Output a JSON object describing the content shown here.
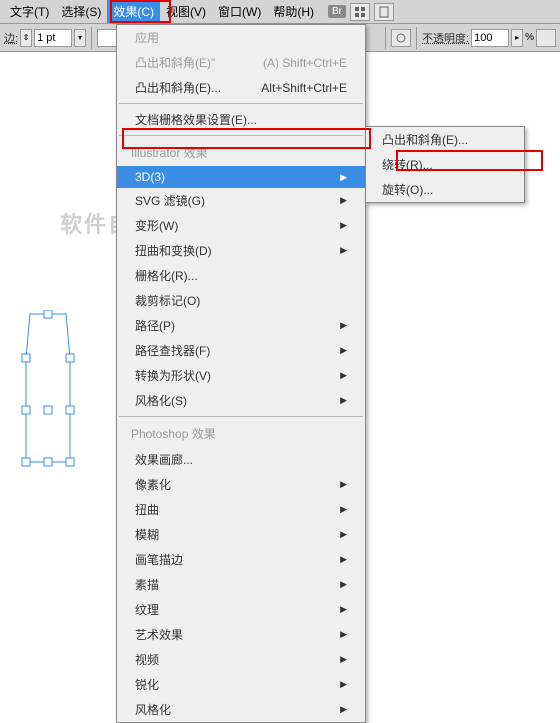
{
  "menubar": {
    "items": [
      "文字(T)",
      "选择(S)",
      "效果(C)",
      "视图(V)",
      "窗口(W)",
      "帮助(H)"
    ],
    "br": "Br"
  },
  "toolbar": {
    "stroke_label": "边:",
    "stroke_value": "1 pt",
    "opacity_label": "不透明度:",
    "opacity_value": "100",
    "percent": "%"
  },
  "dropdown": {
    "row0": {
      "label": "应用",
      "shortcut": ""
    },
    "row1": {
      "label": "凸出和斜角(E)\"",
      "shortcut": "(A)   Shift+Ctrl+E"
    },
    "row2": {
      "label": "凸出和斜角(E)...",
      "shortcut": "Alt+Shift+Ctrl+E"
    },
    "row3": {
      "label": "文档栅格效果设置(E)..."
    },
    "header1": "Illustrator  效果",
    "row4": {
      "label": "3D(3)"
    },
    "row5": {
      "label": "SVG 滤镜(G)"
    },
    "row6": {
      "label": "变形(W)"
    },
    "row7": {
      "label": "扭曲和变换(D)"
    },
    "row8": {
      "label": "栅格化(R)..."
    },
    "row9": {
      "label": "裁剪标记(O)"
    },
    "row10": {
      "label": "路径(P)"
    },
    "row11": {
      "label": "路径查找器(F)"
    },
    "row12": {
      "label": "转换为形状(V)"
    },
    "row13": {
      "label": "风格化(S)"
    },
    "header2": "Photoshop  效果",
    "row14": {
      "label": "效果画廊..."
    },
    "row15": {
      "label": "像素化"
    },
    "row16": {
      "label": "扭曲"
    },
    "row17": {
      "label": "模糊"
    },
    "row18": {
      "label": "画笔描边"
    },
    "row19": {
      "label": "素描"
    },
    "row20": {
      "label": "纹理"
    },
    "row21": {
      "label": "艺术效果"
    },
    "row22": {
      "label": "视频"
    },
    "row23": {
      "label": "锐化"
    },
    "row24": {
      "label": "风格化"
    }
  },
  "submenu": {
    "item0": "凸出和斜角(E)...",
    "item1": "绕转(R)...",
    "item2": "旋转(O)..."
  },
  "watermark": "软件自学网"
}
